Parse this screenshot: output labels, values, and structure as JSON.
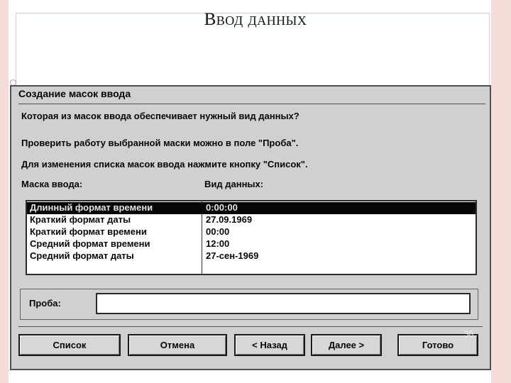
{
  "slide": {
    "title": "Ввод данных",
    "page_number": "38"
  },
  "dialog": {
    "title": "Создание масок ввода",
    "question": "Которая из масок ввода обеспечивает нужный вид данных?",
    "hint_probe": "Проверить работу выбранной маски можно в поле \"Проба\".",
    "hint_list": "Для изменения списка масок ввода нажмите кнопку \"Список\".",
    "col_mask": "Маска ввода:",
    "col_data": "Вид данных:",
    "rows": [
      {
        "mask": "Длинный формат времени",
        "data": "0:00:00",
        "selected": true
      },
      {
        "mask": "Краткий формат даты",
        "data": "27.09.1969",
        "selected": false
      },
      {
        "mask": "Краткий формат времени",
        "data": "00:00",
        "selected": false
      },
      {
        "mask": "Средний формат времени",
        "data": "12:00",
        "selected": false
      },
      {
        "mask": "Средний формат даты",
        "data": "27-сен-1969",
        "selected": false
      }
    ],
    "probe_label": "Проба:",
    "probe_value": "",
    "buttons": {
      "list": "Список",
      "cancel": "Отмена",
      "back": "< Назад",
      "next": "Далее >",
      "finish": "Готово"
    }
  }
}
